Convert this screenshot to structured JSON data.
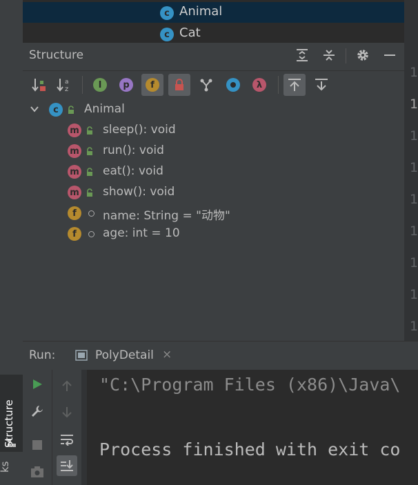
{
  "popup": {
    "items": [
      {
        "label": "Animal",
        "icon": "class-icon",
        "selected": true
      },
      {
        "label": "Cat",
        "icon": "class-icon",
        "selected": false
      }
    ]
  },
  "structure": {
    "title": "Structure",
    "header_icons": [
      "expand-all-icon",
      "collapse-all-icon",
      "gear-icon",
      "minimize-icon"
    ],
    "toolbar": [
      {
        "icon": "sort-by-visibility-icon",
        "active": false
      },
      {
        "icon": "sort-alphabetically-icon",
        "active": false
      },
      {
        "icon": "show-inherited-icon",
        "active": false
      },
      {
        "icon": "show-properties-icon",
        "active": false,
        "glyph": "p"
      },
      {
        "icon": "show-fields-icon",
        "active": true,
        "glyph": "f"
      },
      {
        "icon": "show-non-public-icon",
        "active": true
      },
      {
        "icon": "show-lambdas-icon",
        "active": false
      },
      {
        "icon": "show-anonymous-icon",
        "active": false
      },
      {
        "icon": "lambda-icon",
        "active": false,
        "glyph": "λ"
      },
      {
        "icon": "autoscroll-to-source-icon",
        "active": true
      },
      {
        "icon": "autoscroll-from-source-icon",
        "active": false
      }
    ],
    "root": {
      "label": "Animal",
      "badge": "c"
    },
    "members": [
      {
        "badge": "m",
        "label": "sleep(): void",
        "visibility": "public"
      },
      {
        "badge": "m",
        "label": "run(): void",
        "visibility": "public"
      },
      {
        "badge": "m",
        "label": "eat(): void",
        "visibility": "public"
      },
      {
        "badge": "m",
        "label": "show(): void",
        "visibility": "public"
      },
      {
        "badge": "f",
        "label": "name: String = \"动物\"",
        "visibility": "package"
      },
      {
        "badge": "f",
        "label": "age: int = 10",
        "visibility": "package"
      }
    ]
  },
  "gutter": {
    "line_digit": "1"
  },
  "side_tabs": {
    "structure": "Structure",
    "bookmarks_partial": "ks"
  },
  "run": {
    "label": "Run:",
    "tab_label": "PolyDetail",
    "tab_close": "×",
    "console": [
      "\"C:\\Program Files (x86)\\Java\\",
      "",
      "",
      "Process finished with exit co"
    ]
  },
  "colors": {
    "accent": "#4a88c7",
    "method_badge": "#b8566b",
    "field_badge": "#b58a2e",
    "class_badge": "#3592c4",
    "selection": "#0d293e"
  }
}
